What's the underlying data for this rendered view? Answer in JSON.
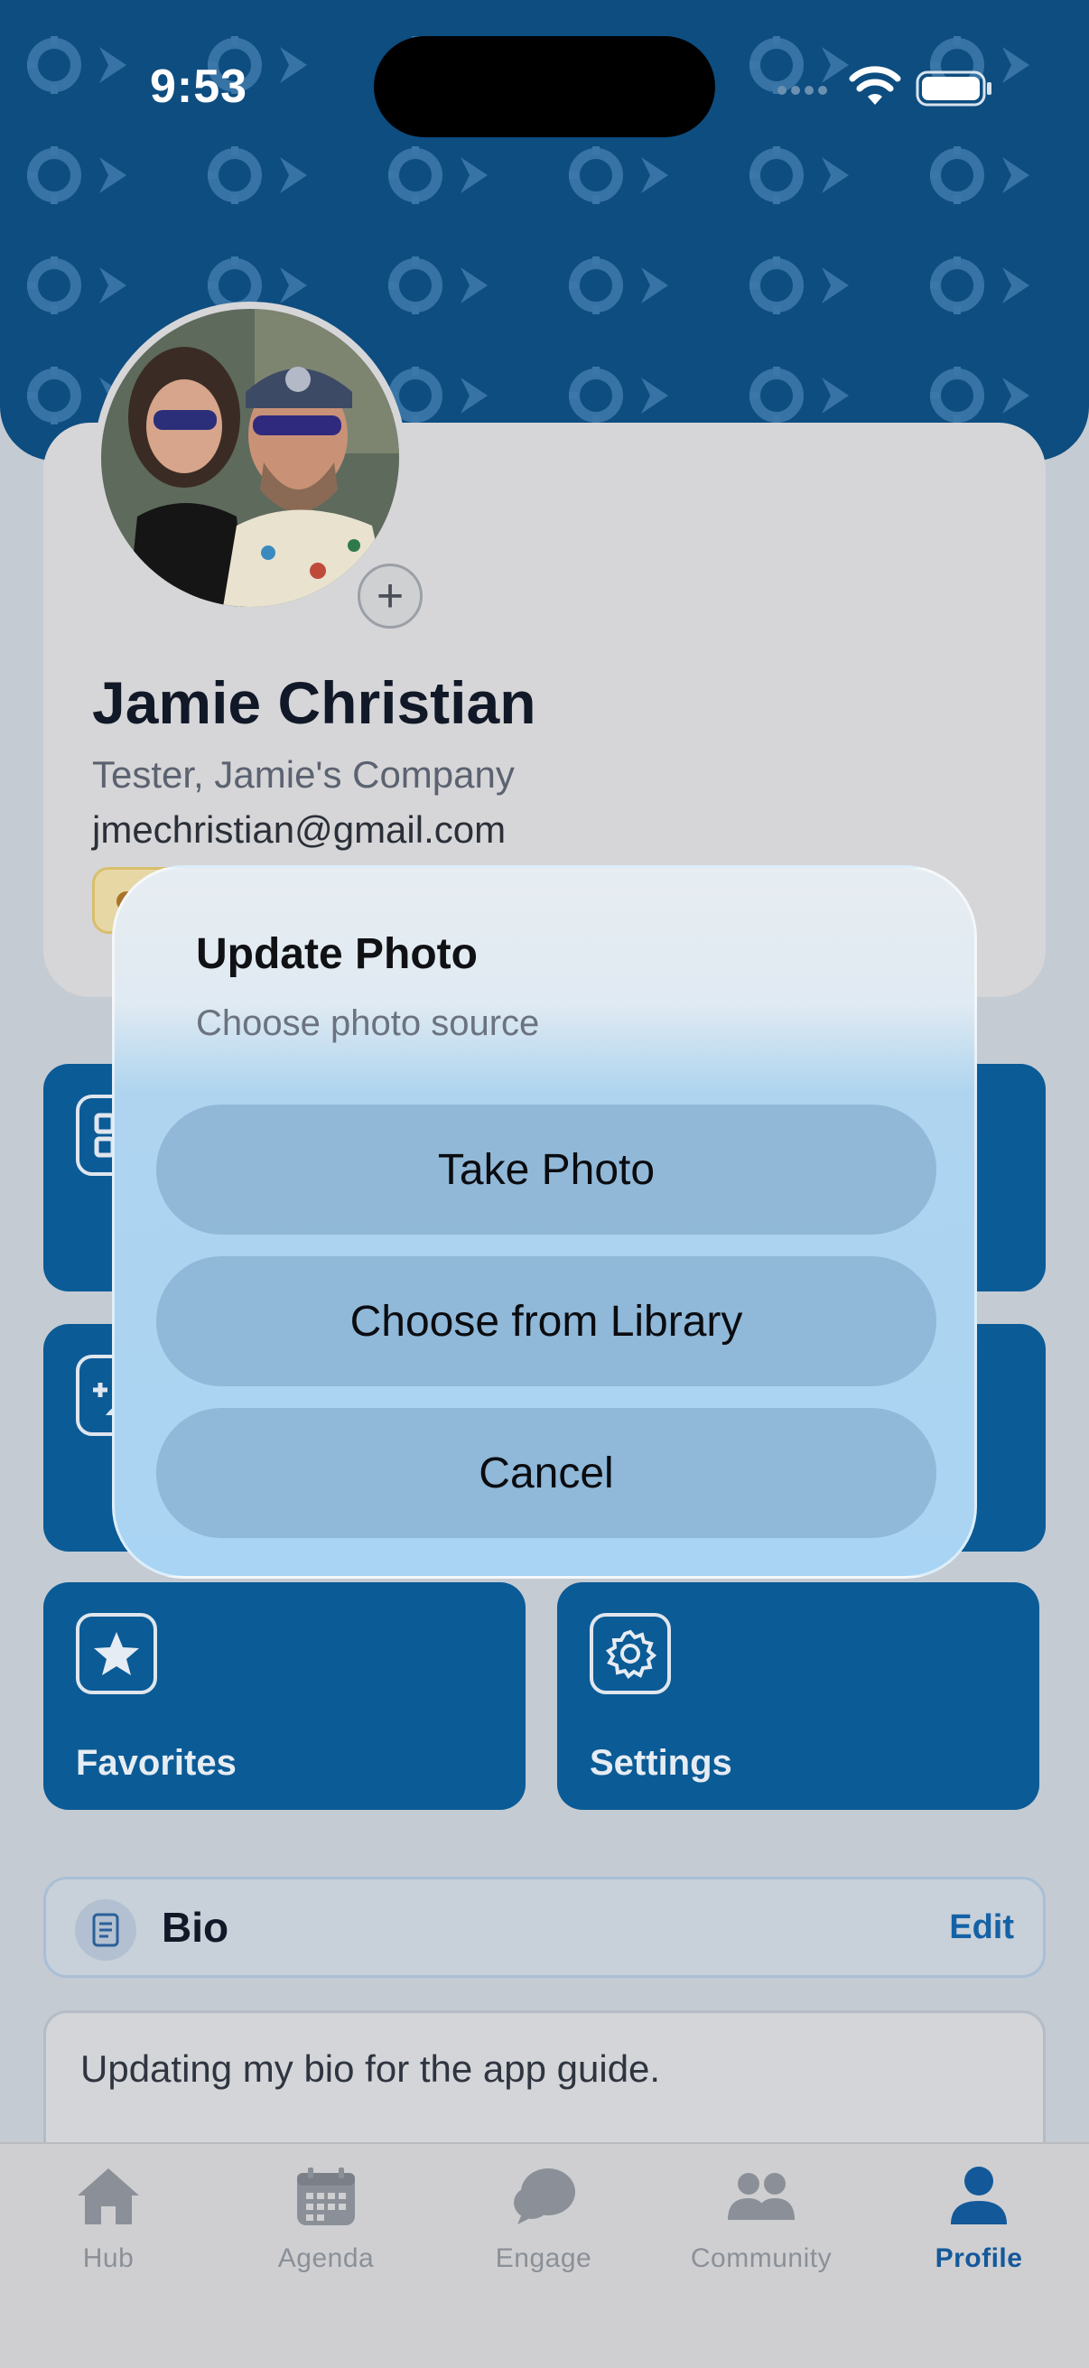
{
  "status_bar": {
    "time": "9:53"
  },
  "profile": {
    "name": "Jamie Christian",
    "role": "Tester, Jamie's Company",
    "email": "jmechristian@gmail.com",
    "add_photo_glyph": "+"
  },
  "tiles": [
    {
      "label": "",
      "icon": "grid-icon"
    },
    {
      "label": "",
      "icon": "unknown-icon"
    },
    {
      "label": "",
      "icon": "add-contact-icon"
    },
    {
      "label": "",
      "icon": "unknown-icon"
    },
    {
      "label": "Favorites",
      "icon": "star-icon"
    },
    {
      "label": "Settings",
      "icon": "gear-icon"
    }
  ],
  "bio": {
    "title": "Bio",
    "edit_label": "Edit",
    "text": "Updating my bio for the app guide."
  },
  "modal": {
    "title": "Update Photo",
    "subtitle": "Choose photo source",
    "buttons": {
      "take_photo": "Take Photo",
      "choose_library": "Choose from Library",
      "cancel": "Cancel"
    }
  },
  "tab_bar": {
    "items": [
      {
        "label": "Hub",
        "icon": "home-icon"
      },
      {
        "label": "Agenda",
        "icon": "calendar-icon"
      },
      {
        "label": "Engage",
        "icon": "chat-bubble-icon"
      },
      {
        "label": "Community",
        "icon": "people-icon"
      },
      {
        "label": "Profile",
        "icon": "person-icon"
      }
    ],
    "active": "Profile"
  },
  "colors": {
    "brand_blue": "#0b5b96",
    "banner_blue": "#0d4d80",
    "active_tab": "#13599a"
  }
}
